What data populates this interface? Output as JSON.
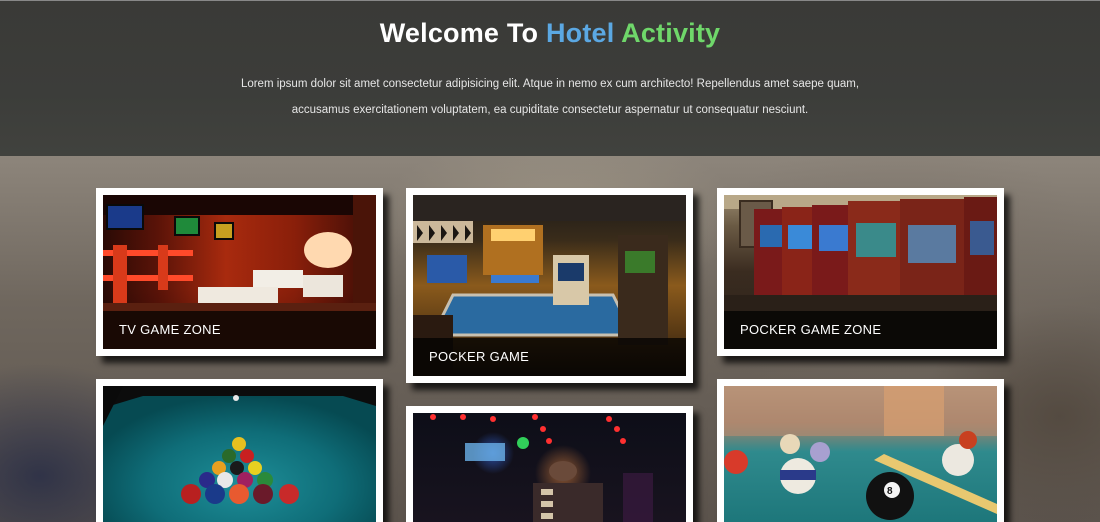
{
  "header": {
    "title_part1": "Welcome To",
    "title_part2": "Hotel",
    "title_part3": "Activity",
    "intro_line1": "Lorem ipsum dolor sit amet consectetur adipisicing elit. Atque in nemo ex cum architecto! Repellendus amet saepe quam,",
    "intro_line2": "accusamus exercitationem voluptatem, ea cupiditate consectetur aspernatur ut consequatur nesciunt."
  },
  "colors": {
    "title_accent_blue": "#5ba8e3",
    "title_accent_green": "#6fd76a",
    "header_bg": "#3c3d3a",
    "caption_bg": "rgba(0,0,0,0.72)"
  },
  "gallery": {
    "cards": [
      {
        "caption": "TV GAME ZONE",
        "image": "tv-game-zone-photo"
      },
      {
        "caption": "POCKER GAME",
        "image": "arcade-game-photo"
      },
      {
        "caption": "POCKER GAME ZONE",
        "image": "arcade-cabinets-photo"
      },
      {
        "caption": "",
        "image": "billiard-rack-photo"
      },
      {
        "caption": "",
        "image": "night-club-photo"
      },
      {
        "caption": "",
        "image": "eight-ball-photo"
      }
    ]
  }
}
